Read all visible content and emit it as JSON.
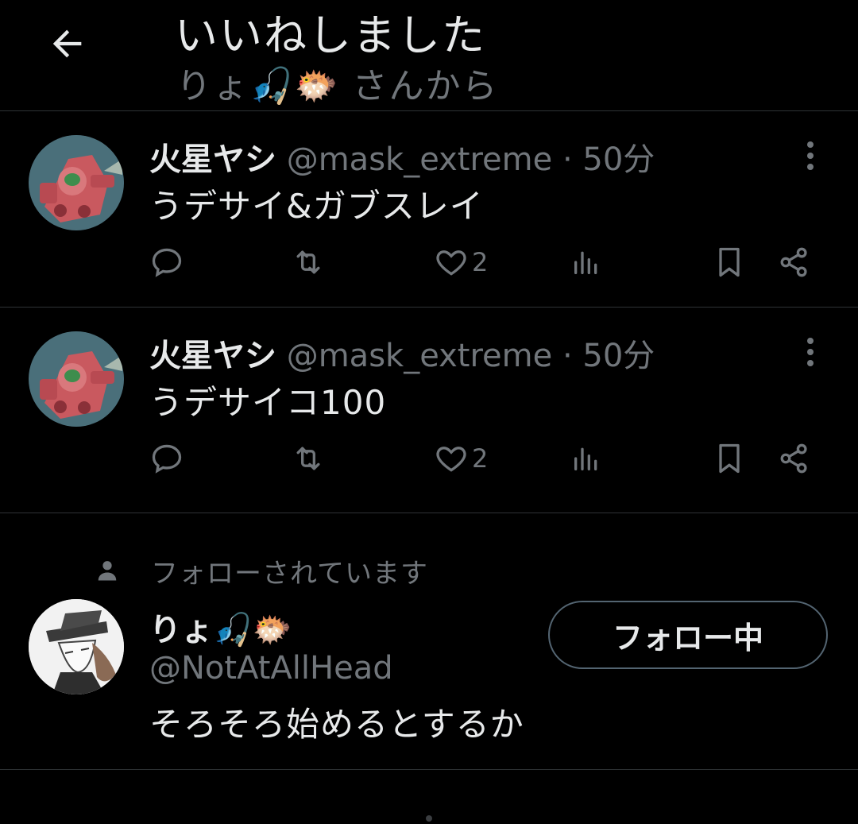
{
  "header": {
    "title": "いいねしました",
    "subtitle": "りょ🎣🐡 さんから"
  },
  "tweets": [
    {
      "name": "火星ヤシ",
      "handle": "@mask_extreme",
      "separator": "·",
      "time": "50分",
      "text": "うデサイ&ガブスレイ",
      "likes": "2"
    },
    {
      "name": "火星ヤシ",
      "handle": "@mask_extreme",
      "separator": "·",
      "time": "50分",
      "text": "うデサイコ100",
      "likes": "2"
    }
  ],
  "follow_card": {
    "followed_label": "フォローされています",
    "name": "りょ🎣🐡",
    "handle": "@NotAtAllHead",
    "bio": "そろそろ始めるとするか",
    "button_label": "フォロー中"
  },
  "icons": [
    "back-arrow-icon",
    "more-icon",
    "reply-icon",
    "retweet-icon",
    "heart-icon",
    "views-icon",
    "bookmark-icon",
    "share-icon",
    "person-icon"
  ],
  "colors": {
    "background": "#000000",
    "text": "#e7e9ea",
    "muted": "#71767b",
    "divider": "#2f3336"
  }
}
